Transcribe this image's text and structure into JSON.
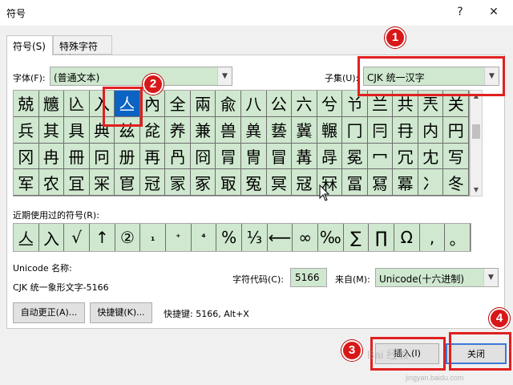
{
  "window": {
    "title": "符号",
    "help_glyph": "?",
    "close_glyph": "✕"
  },
  "tabs": [
    {
      "label": "符号(S)",
      "active": true
    },
    {
      "label": "特殊字符(P)",
      "active": false
    }
  ],
  "font": {
    "label": "字体(F):",
    "value": "(普通文本)"
  },
  "subset": {
    "label": "子集(U):",
    "value": "CJK 统一汉字"
  },
  "symbol_grid": {
    "rows": [
      [
        "兢",
        "兤",
        "兦",
        "入",
        "亼",
        "內",
        "全",
        "兩",
        "兪",
        "八",
        "公",
        "六",
        "兮",
        "兯",
        "兰",
        "共",
        "兲",
        "关",
        "兴"
      ],
      [
        "兵",
        "其",
        "具",
        "典",
        "兹",
        "兺",
        "养",
        "兼",
        "兽",
        "兾",
        "兿",
        "冀",
        "冁",
        "冂",
        "冃",
        "冄",
        "内",
        "円",
        "冇"
      ],
      [
        "冈",
        "冉",
        "冊",
        "冋",
        "册",
        "再",
        "冎",
        "冏",
        "冐",
        "冑",
        "冒",
        "冓",
        "冔",
        "冕",
        "冖",
        "冗",
        "冘",
        "写",
        "冚"
      ],
      [
        "军",
        "农",
        "冝",
        "冞",
        "冟",
        "冠",
        "冡",
        "冢",
        "冣",
        "冤",
        "冥",
        "冦",
        "冧",
        "冨",
        "冩",
        "冪",
        "冫",
        "冬",
        "冭"
      ]
    ],
    "selected": {
      "row": 0,
      "col": 4
    },
    "selected_glyph": "亼"
  },
  "recent": {
    "label": "近期使用过的符号(R):",
    "symbols": [
      "亼",
      "入",
      "√",
      "↑",
      "②",
      "₁",
      "⁺",
      "⁴",
      "%",
      "⅓",
      "⟵",
      "∞",
      "‰",
      "∑",
      "∏",
      "Ω",
      ",",
      "。",
      "、"
    ]
  },
  "unicode_name": {
    "label": "Unicode 名称:",
    "value": "CJK 统一象形文字-5166"
  },
  "char_code": {
    "label": "字符代码(C):",
    "value": "5166"
  },
  "from": {
    "label": "来自(M):",
    "value": "Unicode(十六进制)"
  },
  "buttons": {
    "autocorrect": "自动更正(A)...",
    "shortcut_key": "快捷键(K)...",
    "shortcut_info": "快捷键: 5166, Alt+X",
    "insert": "插入(I)",
    "close": "关闭"
  },
  "annotations": {
    "badge_1": "1",
    "badge_2": "2",
    "badge_3": "3",
    "badge_4": "4",
    "color": "#e02020"
  },
  "watermark": {
    "main": "Bai 经验",
    "sub": "jingyan.baidu.com"
  }
}
